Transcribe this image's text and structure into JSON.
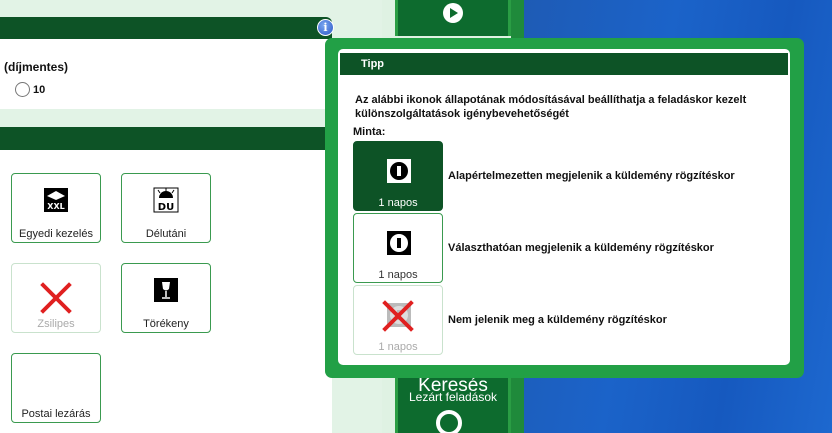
{
  "fee": {
    "label": "(díjmentes)",
    "radio_value": "10"
  },
  "services": [
    {
      "label": "Egyedi kezelés",
      "icon": "xxl-package-icon",
      "icon_text": "XXL",
      "enabled": true
    },
    {
      "label": "Délutáni",
      "icon": "du-sun-icon",
      "icon_text": "DU",
      "enabled": true
    },
    {
      "label": "Zsilipes",
      "icon": "disabled-x-icon",
      "enabled": false
    },
    {
      "label": "Törékeny",
      "icon": "fragile-glass-icon",
      "enabled": true
    },
    {
      "label": "Postai lezárás",
      "icon": "",
      "enabled": true
    }
  ],
  "search": {
    "title": "Keresés",
    "subtitle": "Lezárt feladások",
    "icon": "magnifier-icon"
  },
  "tip": {
    "title": "Tipp",
    "description": "Az alábbi ikonok állapotának módosításával beállíthatja a feladáskor kezelt különszolgáltatások igénybevehetőségét",
    "sample_label": "Minta:",
    "samples": [
      {
        "caption": "1 napos",
        "state": "default",
        "text": "Alapértelmezetten megjelenik  a küldemény rögzítéskor"
      },
      {
        "caption": "1 napos",
        "state": "optional",
        "text": "Választhatóan megjelenik a küldemény rögzítéskor"
      },
      {
        "caption": "1 napos",
        "state": "hidden",
        "text": "Nem jelenik meg a küldemény rögzítéskor"
      }
    ]
  },
  "colors": {
    "dark_green": "#0d5326",
    "accent_green": "#22a046",
    "blue_bg": "#1b63c9",
    "disabled_red": "#e02020"
  }
}
